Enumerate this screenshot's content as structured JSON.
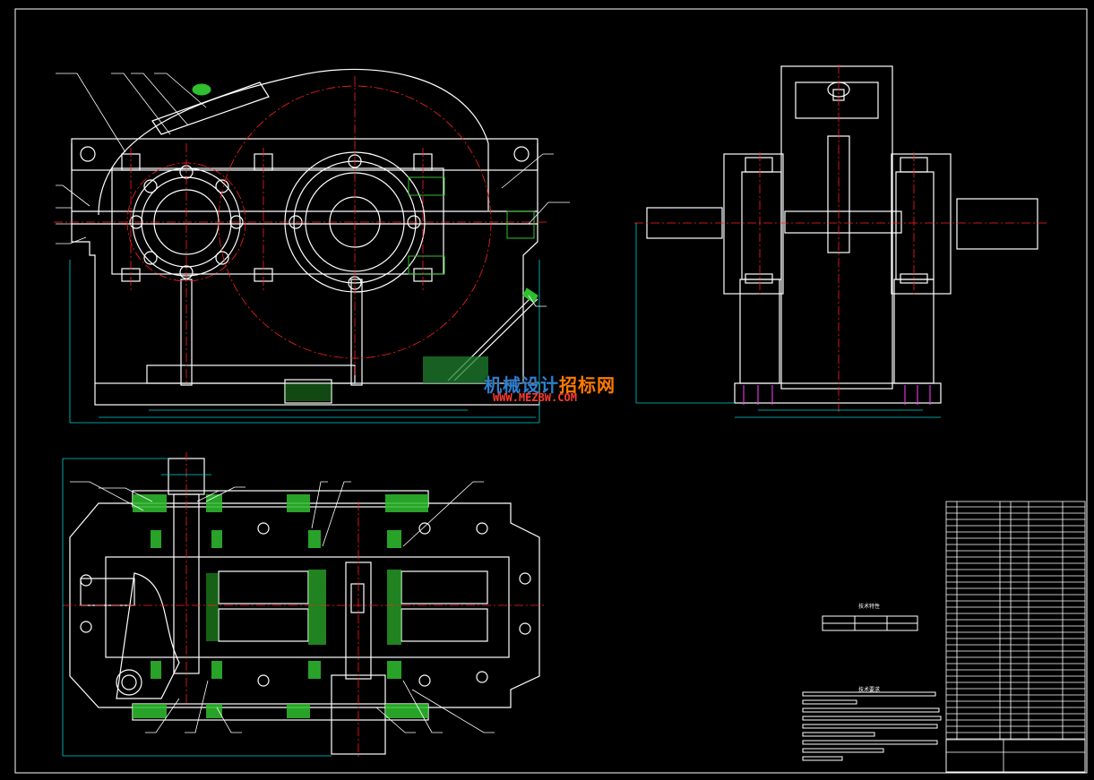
{
  "drawing": {
    "background": "#000000",
    "colors": {
      "outline": "#ffffff",
      "centerline": "#ff2020",
      "dimension": "#00d0d0",
      "hatch": "#2fbf2f",
      "oil": "#1f9f3f",
      "magenta": "#ff40ff",
      "yellow": "#e0e000"
    }
  },
  "watermark": {
    "text_blue": "机械设计",
    "text_orange": "招标网",
    "url": "WWW.MEZBW.COM"
  },
  "notes": {
    "tech_features_title": "技术特性",
    "tech_requirements_title": "技术要求"
  },
  "views": [
    "front-view",
    "side-view",
    "top-section-view",
    "title-block-table"
  ]
}
